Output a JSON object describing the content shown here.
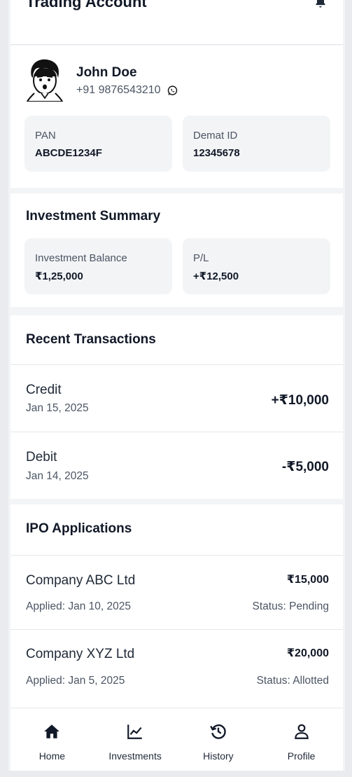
{
  "header": {
    "title": "Trading Account",
    "notification_icon": "bell-icon"
  },
  "profile": {
    "name": "John Doe",
    "phone": "+91 9876543210",
    "pan": {
      "label": "PAN",
      "value": "ABCDE1234F"
    },
    "demat": {
      "label": "Demat ID",
      "value": "12345678"
    }
  },
  "summary": {
    "title": "Investment Summary",
    "balance": {
      "label": "Investment Balance",
      "value": "₹1,25,000"
    },
    "pl": {
      "label": "P/L",
      "value": "+₹12,500"
    }
  },
  "transactions": {
    "title": "Recent Transactions",
    "items": [
      {
        "type": "Credit",
        "date": "Jan 15, 2025",
        "amount": "+₹10,000"
      },
      {
        "type": "Debit",
        "date": "Jan 14, 2025",
        "amount": "-₹5,000"
      }
    ]
  },
  "ipo": {
    "title": "IPO Applications",
    "items": [
      {
        "company": "Company ABC Ltd",
        "applied": "Applied: Jan 10, 2025",
        "amount": "₹15,000",
        "status": "Status: Pending"
      },
      {
        "company": "Company XYZ Ltd",
        "applied": "Applied: Jan 5, 2025",
        "amount": "₹20,000",
        "status": "Status: Allotted"
      }
    ]
  },
  "nav": {
    "items": [
      {
        "label": "Home",
        "icon": "home-icon"
      },
      {
        "label": "Investments",
        "icon": "chart-line-icon"
      },
      {
        "label": "History",
        "icon": "history-icon"
      },
      {
        "label": "Profile",
        "icon": "user-icon"
      }
    ]
  },
  "colors": {
    "background": "#f3f4f6",
    "card": "#ffffff",
    "text": "#111827",
    "muted": "#4b5563"
  }
}
